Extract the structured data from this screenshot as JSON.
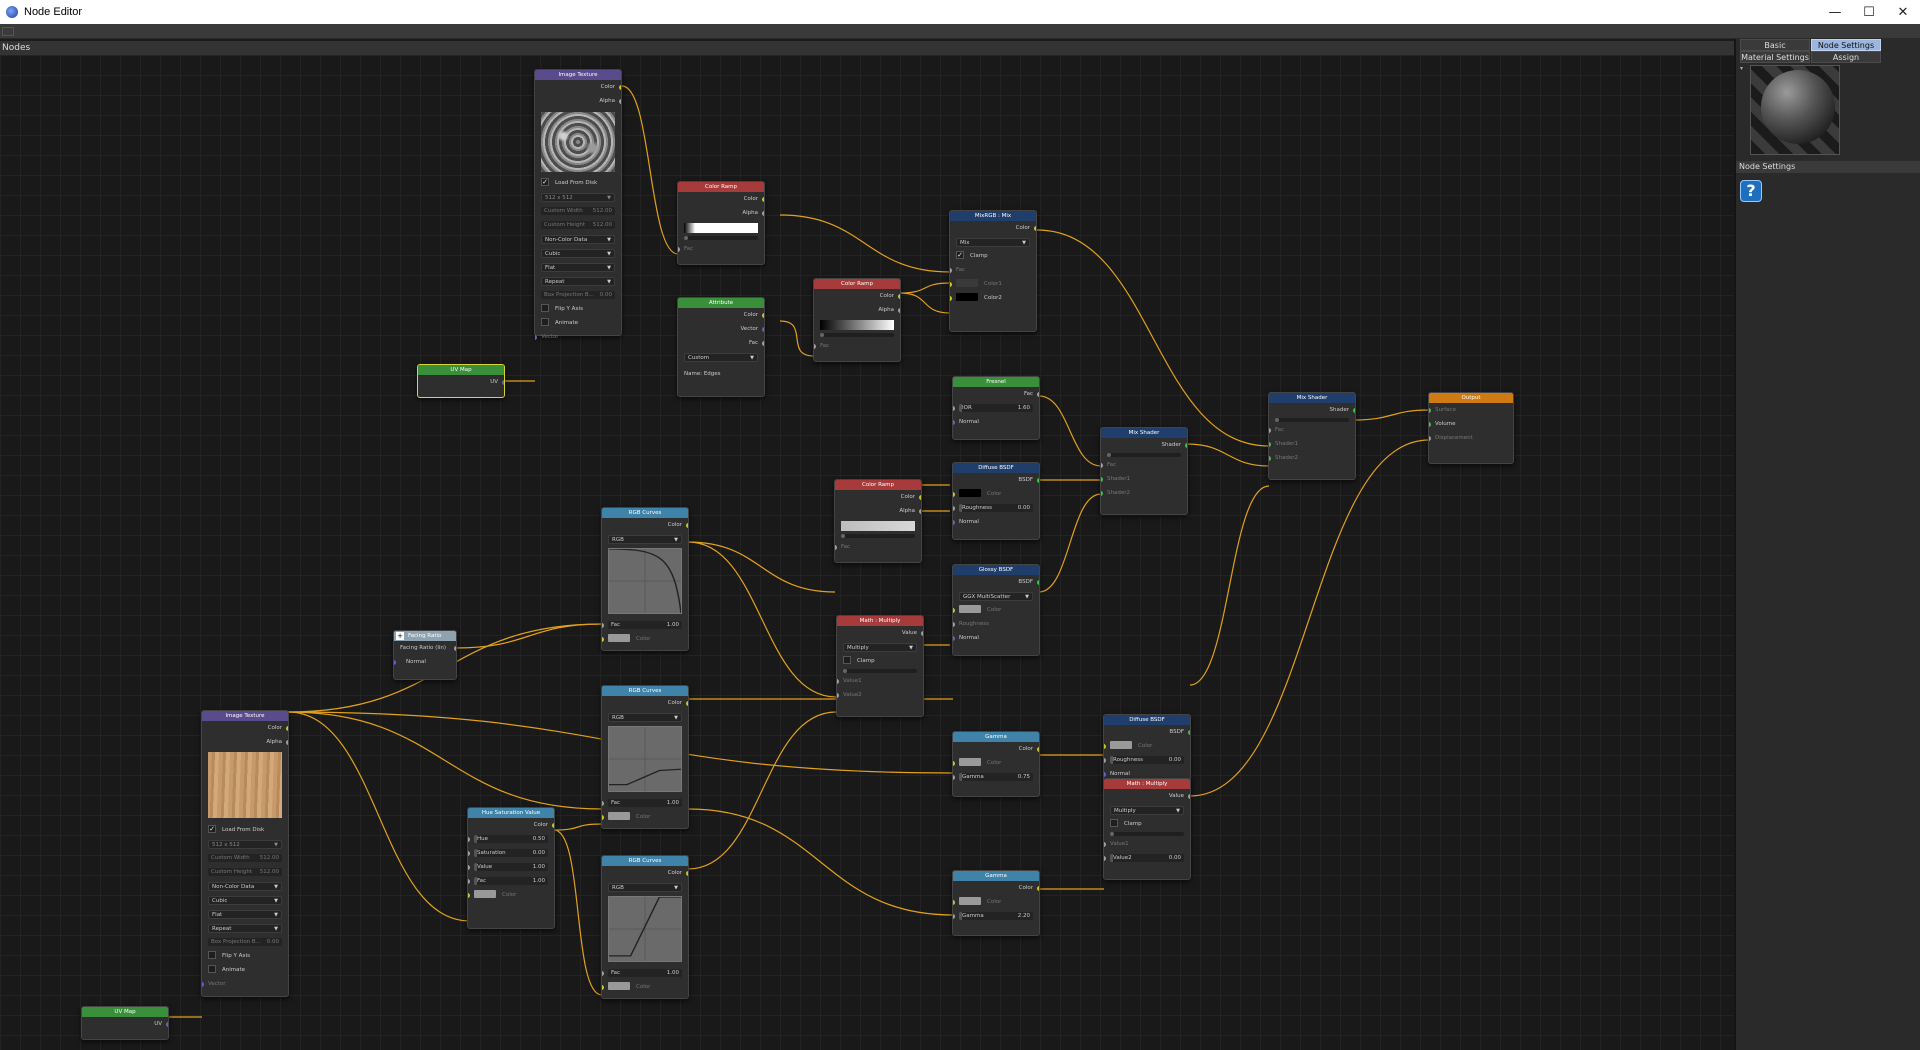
{
  "window": {
    "title": "Node Editor",
    "minimize": "—",
    "maximize": "☐",
    "close": "✕"
  },
  "panel": {
    "nodes_title": "Nodes"
  },
  "right_panel": {
    "tabs": {
      "basic": "Basic",
      "node_settings": "Node Settings",
      "material_settings": "Material Settings",
      "assign": "Assign"
    },
    "section_title": "Node Settings",
    "help": "?",
    "collapse": "▾"
  },
  "nodes": {
    "image_texture_1": {
      "title": "Image Texture",
      "color": "Color",
      "alpha": "Alpha",
      "load_from_disk": "Load From Disk",
      "size": "512 x 512",
      "custom_width": "Custom Width",
      "custom_width_val": "512.00",
      "custom_height": "Custom Height",
      "custom_height_val": "512.00",
      "color_space": "Non-Color Data",
      "interp": "Cubic",
      "projection": "Flat",
      "extension": "Repeat",
      "box_blend": "Box Projection B...",
      "box_blend_val": "0.00",
      "flip_y": "Flip Y Axis",
      "animate": "Animate",
      "vector": "Vector"
    },
    "uv_map_1": {
      "title": "UV Map",
      "uv": "UV"
    },
    "color_ramp_1": {
      "title": "Color Ramp",
      "color": "Color",
      "alpha": "Alpha",
      "fac": "Fac"
    },
    "attribute": {
      "title": "Attribute",
      "color": "Color",
      "vector": "Vector",
      "fac": "Fac",
      "type": "Custom",
      "name": "Name: Edges"
    },
    "color_ramp_2": {
      "title": "Color Ramp",
      "color": "Color",
      "alpha": "Alpha",
      "fac": "Fac"
    },
    "mix_rgb": {
      "title": "MixRGB : Mix",
      "color": "Color",
      "mode": "Mix",
      "clamp": "Clamp",
      "fac": "Fac",
      "color1": "Color1",
      "color2": "Color2"
    },
    "fresnel": {
      "title": "Fresnel",
      "fac": "Fac",
      "ior": "IOR",
      "ior_val": "1.60",
      "normal": "Normal"
    },
    "mix_shader_1": {
      "title": "Mix Shader",
      "shader": "Shader",
      "fac": "Fac",
      "shader1": "Shader1",
      "shader2": "Shader2"
    },
    "mix_shader_2": {
      "title": "Mix Shader",
      "shader": "Shader",
      "fac": "Fac",
      "shader1": "Shader1",
      "shader2": "Shader2"
    },
    "output": {
      "title": "Output",
      "surface": "Surface",
      "volume": "Volume",
      "displacement": "Displacement"
    },
    "color_ramp_3": {
      "title": "Color Ramp",
      "color": "Color",
      "alpha": "Alpha",
      "fac": "Fac"
    },
    "diffuse_1": {
      "title": "Diffuse BSDF",
      "bsdf": "BSDF",
      "color": "Color",
      "roughness": "Roughness",
      "roughness_val": "0.00",
      "normal": "Normal"
    },
    "glossy": {
      "title": "Glossy BSDF",
      "bsdf": "BSDF",
      "dist": "GGX MultiScatter",
      "color": "Color",
      "roughness": "Roughness",
      "normal": "Normal"
    },
    "rgb_curves_1": {
      "title": "RGB Curves",
      "color": "Color",
      "mode": "RGB",
      "fac": "Fac",
      "fac_val": "1.00",
      "color_in": "Color"
    },
    "facing_ratio": {
      "title": "Facing Ratio",
      "out": "Facing Ratio (lin)",
      "normal": "Normal"
    },
    "math_multiply_1": {
      "title": "Math : Multiply",
      "value": "Value",
      "op": "Multiply",
      "clamp": "Clamp",
      "value1": "Value1",
      "value2": "Value2"
    },
    "gamma_1": {
      "title": "Gamma",
      "color": "Color",
      "color_in": "Color",
      "gamma": "Gamma",
      "gamma_val": "0.75"
    },
    "diffuse_2": {
      "title": "Diffuse BSDF",
      "bsdf": "BSDF",
      "color": "Color",
      "roughness": "Roughness",
      "roughness_val": "0.00",
      "normal": "Normal"
    },
    "image_texture_2": {
      "title": "Image Texture",
      "color": "Color",
      "alpha": "Alpha",
      "load_from_disk": "Load From Disk",
      "size": "512 x 512",
      "custom_width": "Custom Width",
      "custom_width_val": "512.00",
      "custom_height": "Custom Height",
      "custom_height_val": "512.00",
      "color_space": "Non-Color Data",
      "interp": "Cubic",
      "projection": "Flat",
      "extension": "Repeat",
      "box_blend": "Box Projection B...",
      "box_blend_val": "0.00",
      "flip_y": "Flip Y Axis",
      "animate": "Animate",
      "vector": "Vector"
    },
    "rgb_curves_2": {
      "title": "RGB Curves",
      "color": "Color",
      "mode": "RGB",
      "fac": "Fac",
      "fac_val": "1.00",
      "color_in": "Color"
    },
    "hsv": {
      "title": "Hue Saturation Value",
      "color": "Color",
      "hue": "Hue",
      "hue_val": "0.50",
      "saturation": "Saturation",
      "saturation_val": "0.00",
      "value": "Value",
      "value_val": "1.00",
      "fac": "Fac",
      "fac_val": "1.00",
      "color_in": "Color"
    },
    "math_multiply_2": {
      "title": "Math : Multiply",
      "value": "Value",
      "op": "Multiply",
      "clamp": "Clamp",
      "value1": "Value1",
      "value2": "Value2",
      "value2_val": "0.00"
    },
    "gamma_2": {
      "title": "Gamma",
      "color": "Color",
      "color_in": "Color",
      "gamma": "Gamma",
      "gamma_val": "2.20"
    },
    "rgb_curves_3": {
      "title": "RGB Curves",
      "color": "Color",
      "mode": "RGB",
      "fac": "Fac",
      "fac_val": "1.00",
      "color_in": "Color"
    },
    "uv_map_2": {
      "title": "UV Map",
      "uv": "UV"
    }
  },
  "colors": {
    "header_texture": "#5a4b8c",
    "header_converter": "#3a8f3a",
    "header_ramp": "#a73a3a",
    "header_shader": "#1f3e6b",
    "header_curves": "#3f83a8",
    "header_output": "#d07a13",
    "header_facing": "#8ea3b2",
    "wire": "#e0a020",
    "selected_outline": "#d6d63a"
  }
}
